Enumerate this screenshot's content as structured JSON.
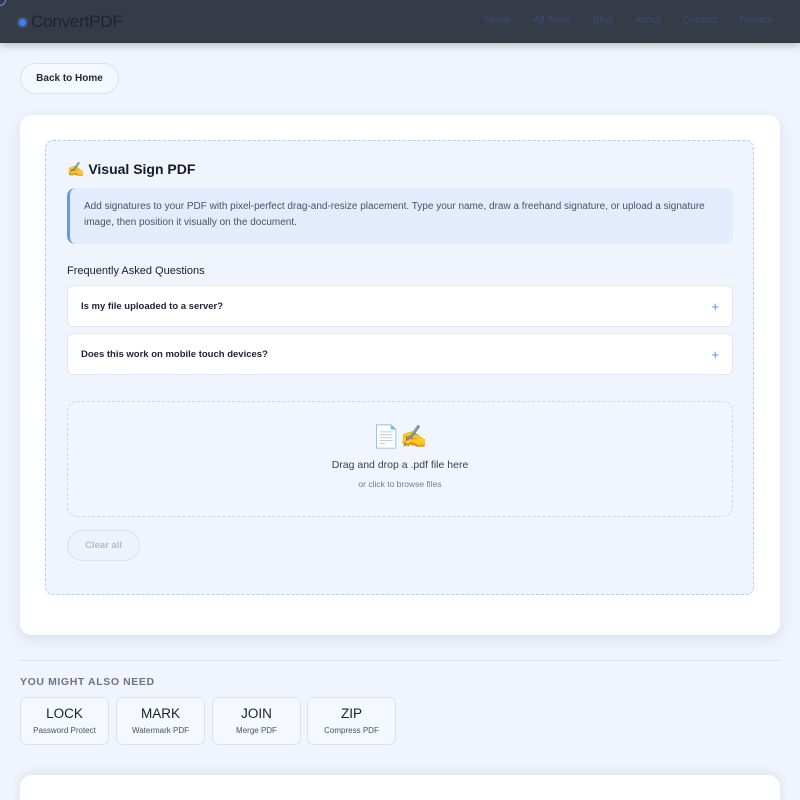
{
  "header": {
    "brand": "ConvertPDF",
    "nav": [
      "Home",
      "All Tools",
      "Blog",
      "About",
      "Contact",
      "Privacy"
    ]
  },
  "back_button": "Back to Home",
  "tool": {
    "title": "✍️ Visual Sign PDF",
    "description": "Add signatures to your PDF with pixel-perfect drag-and-resize placement. Type your name, draw a freehand signature, or upload a signature image, then position it visually on the document.",
    "faq_heading": "Frequently Asked Questions",
    "faqs": [
      {
        "question": "Is my file uploaded to a server?",
        "toggle": "+"
      },
      {
        "question": "Does this work on mobile touch devices?",
        "toggle": "+"
      }
    ],
    "dropzone": {
      "icons": "📄✍️",
      "main": "Drag and drop a .pdf file here",
      "sub": "or click to browse files"
    },
    "clear_button": "Clear all"
  },
  "related": {
    "heading": "YOU MIGHT ALSO NEED",
    "items": [
      {
        "short": "LOCK",
        "label": "Password Protect"
      },
      {
        "short": "MARK",
        "label": "Watermark PDF"
      },
      {
        "short": "JOIN",
        "label": "Merge PDF"
      },
      {
        "short": "ZIP",
        "label": "Compress PDF"
      }
    ]
  },
  "colors": {
    "accent": "#3b82f6",
    "header_bg": "#353b47",
    "page_bg": "#eff4fd"
  }
}
